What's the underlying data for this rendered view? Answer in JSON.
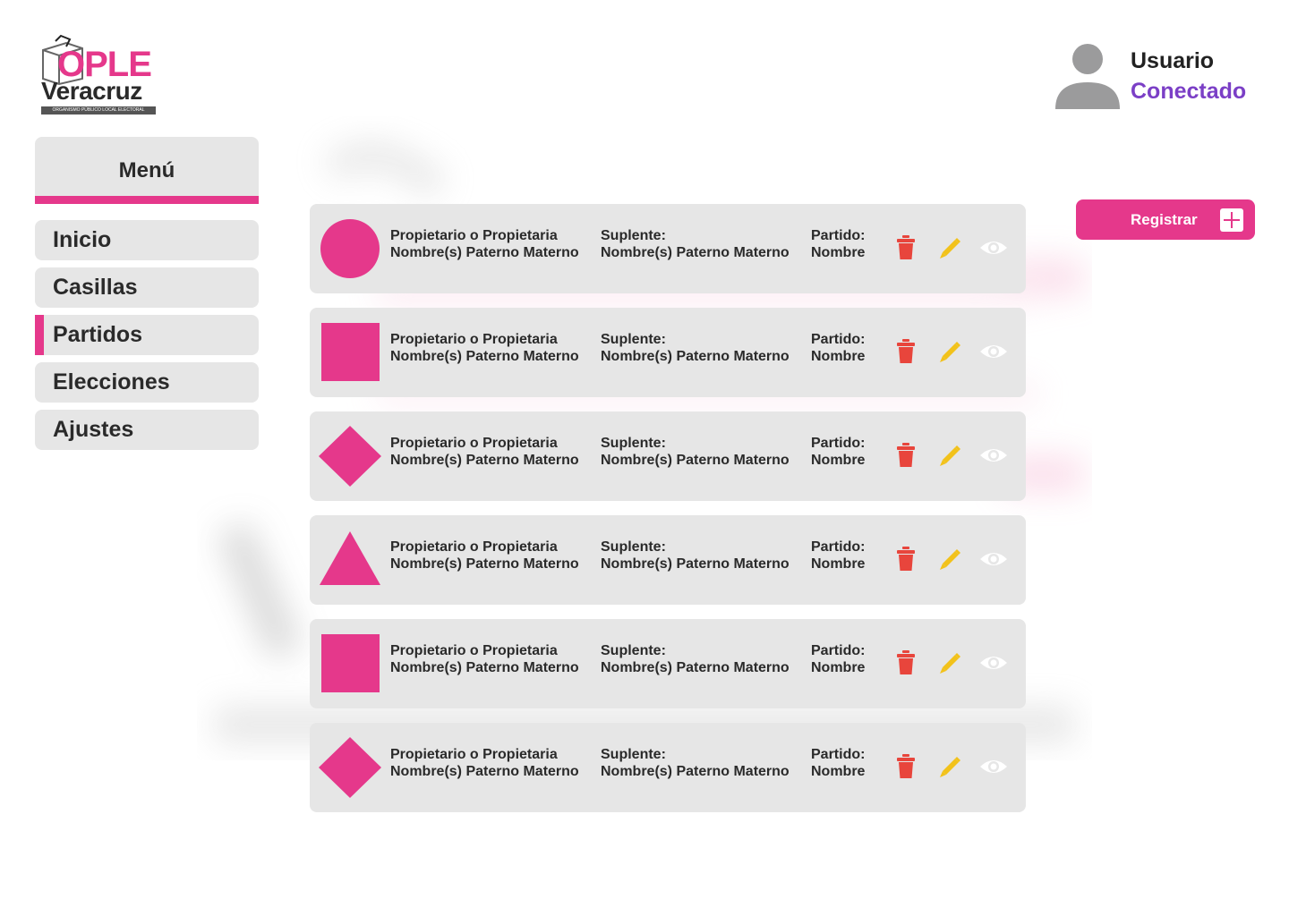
{
  "brand": {
    "logo_main": "OPLE",
    "logo_sub": "Veracruz",
    "logo_tagline": "ORGANISMO PÚBLICO LOCAL ELECTORAL"
  },
  "user": {
    "name": "Usuario",
    "status": "Conectado",
    "status_color": "#7b3fc6",
    "avatar_icon": "user-avatar-icon"
  },
  "menu": {
    "title": "Menú",
    "items": [
      {
        "label": "Inicio",
        "active": false
      },
      {
        "label": "Casillas",
        "active": false
      },
      {
        "label": "Partidos",
        "active": true
      },
      {
        "label": "Elecciones",
        "active": false
      },
      {
        "label": "Ajustes",
        "active": false
      }
    ]
  },
  "register_button": {
    "label": "Registrar",
    "icon": "plus-icon"
  },
  "colors": {
    "accent": "#e5388b",
    "card_bg": "#e6e6e6",
    "delete": "#e8453c",
    "edit": "#f2c21b",
    "view": "#ffffff"
  },
  "parties": [
    {
      "emblem": "circle",
      "owner_label": "Propietario o Propietaria",
      "owner_name": "Nombre(s) Paterno Materno",
      "alternate_label": "Suplente:",
      "alternate_name": "Nombre(s) Paterno Materno",
      "party_label": "Partido:",
      "party_name": "Nombre"
    },
    {
      "emblem": "square",
      "owner_label": "Propietario o Propietaria",
      "owner_name": "Nombre(s) Paterno Materno",
      "alternate_label": "Suplente:",
      "alternate_name": "Nombre(s) Paterno Materno",
      "party_label": "Partido:",
      "party_name": "Nombre"
    },
    {
      "emblem": "diamond",
      "owner_label": "Propietario o Propietaria",
      "owner_name": "Nombre(s) Paterno Materno",
      "alternate_label": "Suplente:",
      "alternate_name": "Nombre(s) Paterno Materno",
      "party_label": "Partido:",
      "party_name": "Nombre"
    },
    {
      "emblem": "triangle",
      "owner_label": "Propietario o Propietaria",
      "owner_name": "Nombre(s) Paterno Materno",
      "alternate_label": "Suplente:",
      "alternate_name": "Nombre(s) Paterno Materno",
      "party_label": "Partido:",
      "party_name": "Nombre"
    },
    {
      "emblem": "square",
      "owner_label": "Propietario o Propietaria",
      "owner_name": "Nombre(s) Paterno Materno",
      "alternate_label": "Suplente:",
      "alternate_name": "Nombre(s) Paterno Materno",
      "party_label": "Partido:",
      "party_name": "Nombre"
    },
    {
      "emblem": "diamond",
      "owner_label": "Propietario o Propietaria",
      "owner_name": "Nombre(s) Paterno Materno",
      "alternate_label": "Suplente:",
      "alternate_name": "Nombre(s) Paterno Materno",
      "party_label": "Partido:",
      "party_name": "Nombre"
    }
  ],
  "row_actions": {
    "delete_icon": "trash-icon",
    "edit_icon": "pencil-icon",
    "view_icon": "eye-icon"
  }
}
